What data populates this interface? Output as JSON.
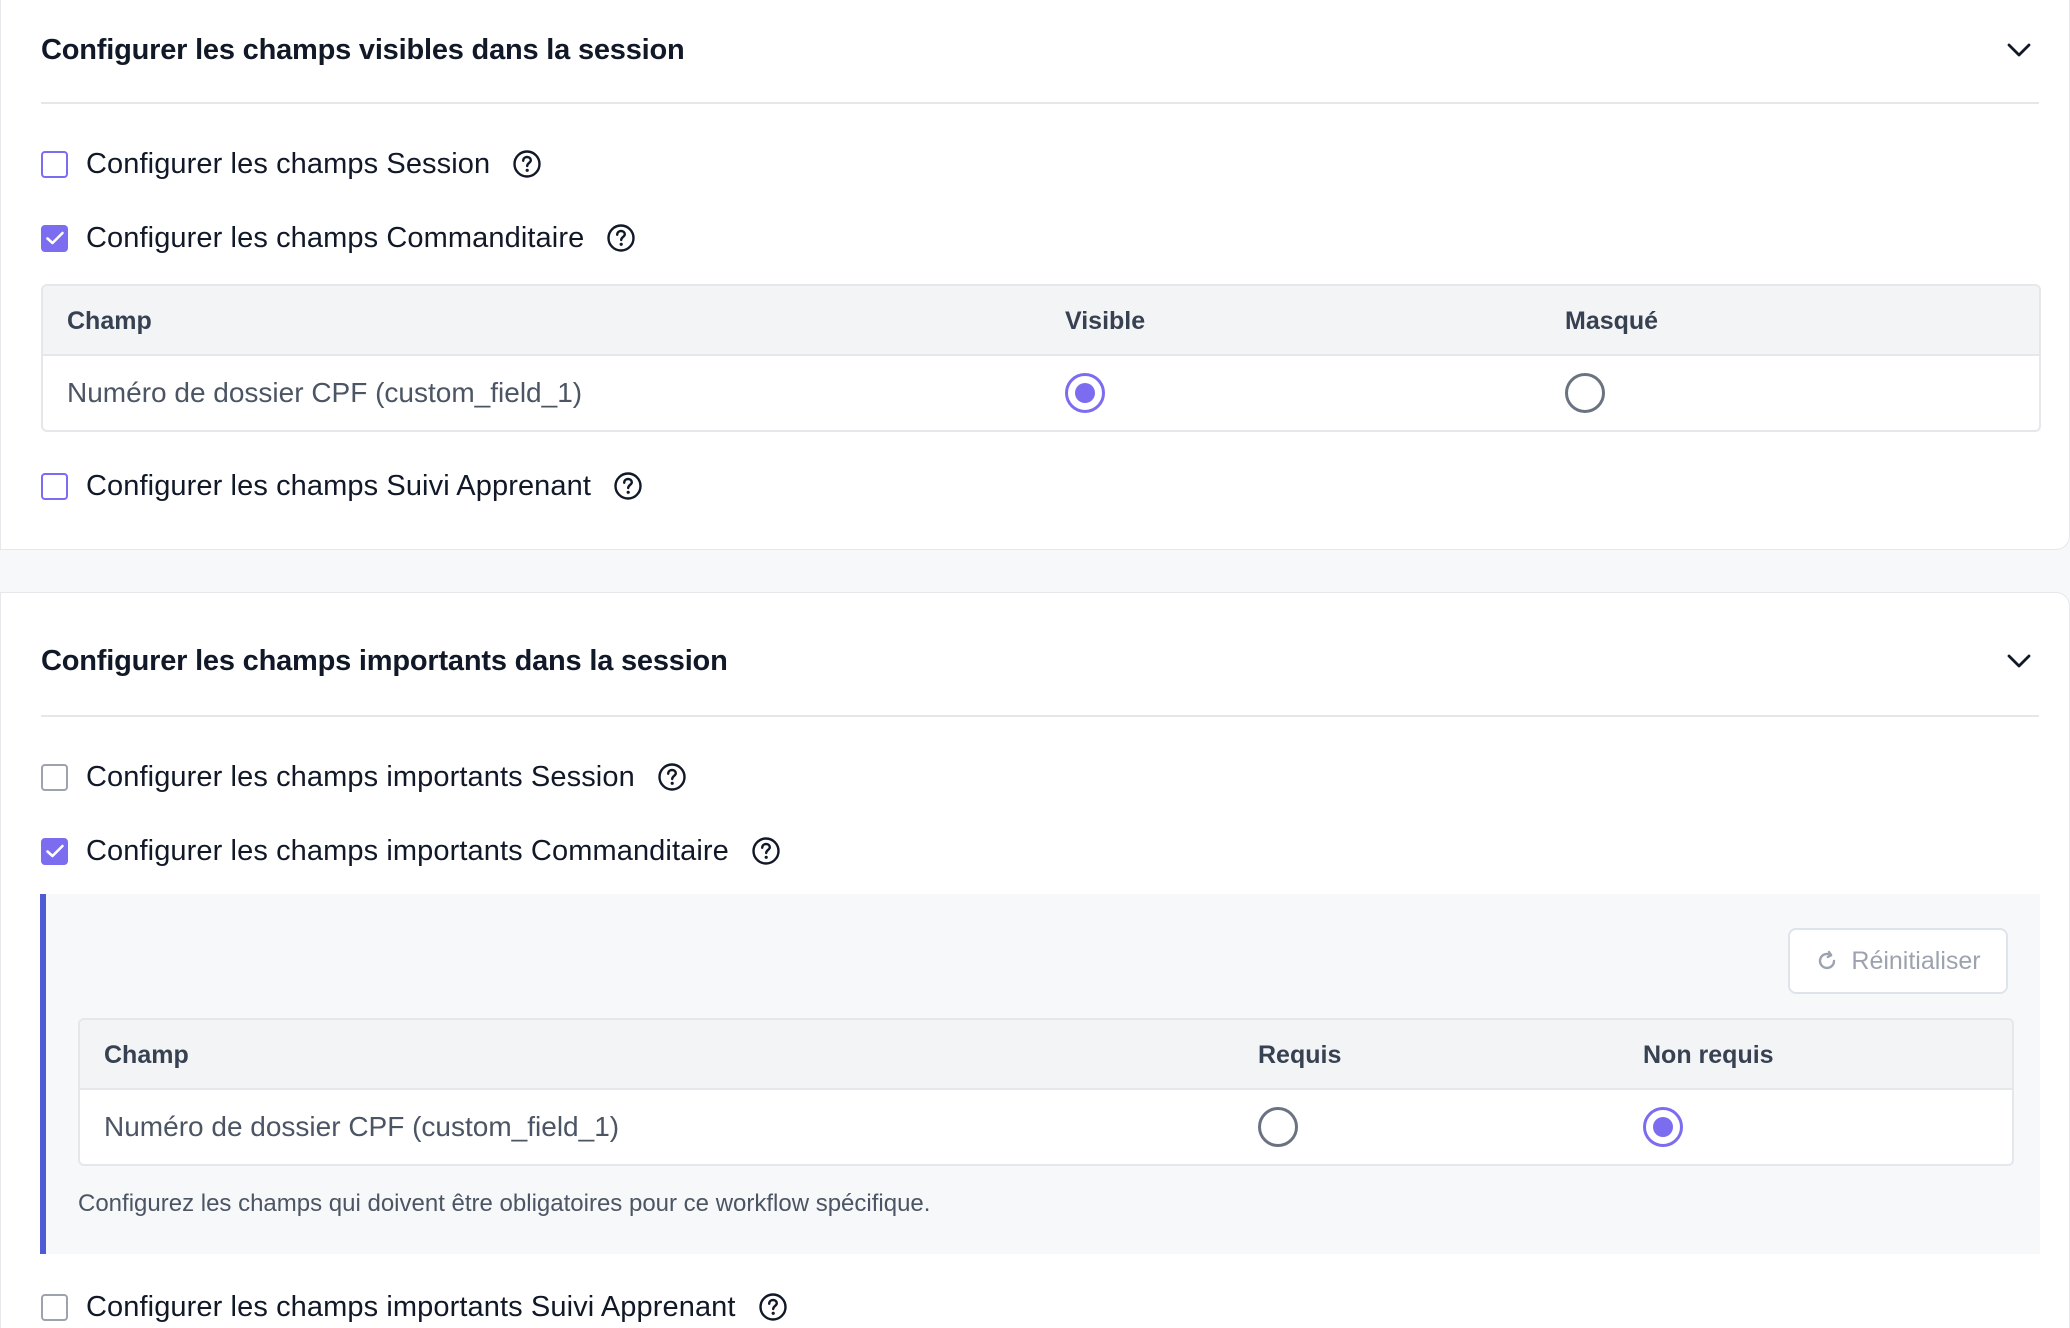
{
  "visible_section": {
    "title": "Configurer les champs visibles dans la session",
    "options": [
      {
        "label": "Configurer les champs Session",
        "checked": false
      },
      {
        "label": "Configurer les champs Commanditaire",
        "checked": true
      },
      {
        "label": "Configurer les champs Suivi Apprenant",
        "checked": false
      }
    ],
    "table": {
      "headers": [
        "Champ",
        "Visible",
        "Masqué"
      ],
      "rows": [
        {
          "field": "Numéro de dossier CPF (custom_field_1)",
          "selected": "Visible"
        }
      ]
    }
  },
  "important_section": {
    "title": "Configurer les champs importants dans la session",
    "options": [
      {
        "label": "Configurer les champs importants Session",
        "checked": false
      },
      {
        "label": "Configurer les champs importants Commanditaire",
        "checked": true
      },
      {
        "label": "Configurer les champs importants Suivi Apprenant",
        "checked": false
      }
    ],
    "reset_label": "Réinitialiser",
    "table": {
      "headers": [
        "Champ",
        "Requis",
        "Non requis"
      ],
      "rows": [
        {
          "field": "Numéro de dossier CPF (custom_field_1)",
          "selected": "Non requis"
        }
      ]
    },
    "note": "Configurez les champs qui doivent être obligatoires pour ce workflow spécifique."
  },
  "colors": {
    "accent": "#7b6cf0",
    "panel_border": "#4f5bd5"
  }
}
